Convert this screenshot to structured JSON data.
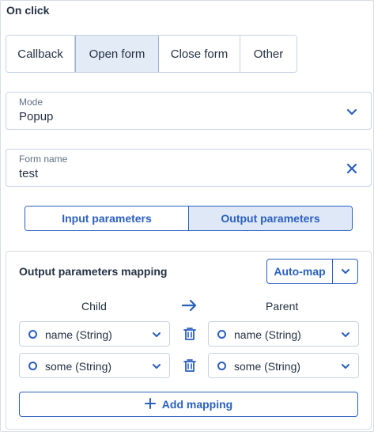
{
  "section_title": "On click",
  "actions": [
    {
      "label": "Callback",
      "active": false
    },
    {
      "label": "Open form",
      "active": true
    },
    {
      "label": "Close form",
      "active": false
    },
    {
      "label": "Other",
      "active": false
    }
  ],
  "mode": {
    "label": "Mode",
    "value": "Popup",
    "icon": "chevron-down-icon"
  },
  "form_name": {
    "label": "Form name",
    "value": "test",
    "icon": "close-icon"
  },
  "param_tabs": [
    {
      "label": "Input parameters",
      "active": false
    },
    {
      "label": "Output parameters",
      "active": true
    }
  ],
  "mapping": {
    "title": "Output parameters mapping",
    "automap_label": "Auto-map",
    "child_header": "Child",
    "parent_header": "Parent",
    "rows": [
      {
        "child": "name (String)",
        "parent": "name (String)"
      },
      {
        "child": "some (String)",
        "parent": "some (String)"
      }
    ],
    "add_label": "Add mapping"
  },
  "colors": {
    "accent": "#2a5fbf",
    "active_bg": "#e3ebf7",
    "text": "#243143",
    "border": "#c6d3e4"
  }
}
